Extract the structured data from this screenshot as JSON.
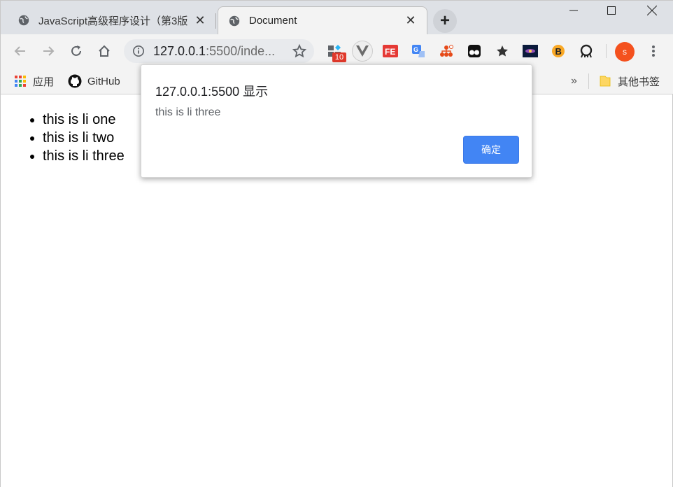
{
  "tabs": [
    {
      "title": "JavaScript高级程序设计（第3版",
      "active": false
    },
    {
      "title": "Document",
      "active": true
    }
  ],
  "address_bar": {
    "host": "127.0.0.1",
    "path": ":5500/inde..."
  },
  "extension_badge": "10",
  "bookmarks": {
    "items": [
      {
        "label": "应用",
        "icon": "apps-grid-icon"
      },
      {
        "label": "GitHub",
        "icon": "github-icon"
      }
    ],
    "overflow_label": "»",
    "other_label": "其他书签"
  },
  "profile_initial": "S",
  "page": {
    "list": [
      "this is li one",
      "this is li two",
      "this is li three"
    ]
  },
  "dialog": {
    "title": "127.0.0.1:5500 显示",
    "message": "this is li three",
    "ok_label": "确定"
  },
  "colors": {
    "accent": "#4285f4",
    "profile": "#f4511e",
    "badge": "#e0392b"
  }
}
